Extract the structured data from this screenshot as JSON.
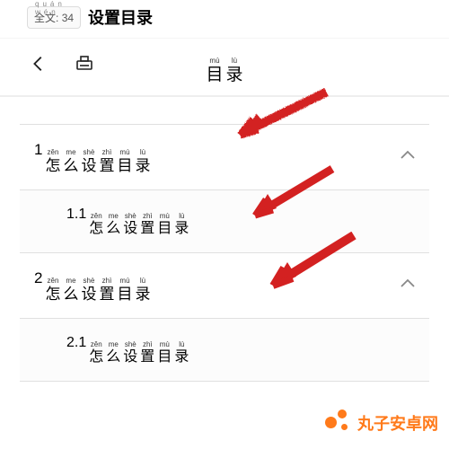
{
  "header": {
    "badge_label": "全文",
    "badge_pinyin": "quán wén",
    "badge_count": "34",
    "partial_title": "设置目录"
  },
  "toolbar": {
    "title": [
      "目",
      "录"
    ],
    "title_pinyin": [
      "mù",
      "lù"
    ]
  },
  "rows": [
    {
      "level": 1,
      "num": "1",
      "chars": [
        "怎",
        "么",
        "设",
        "置",
        "目",
        "录"
      ],
      "pinyin": [
        "zěn",
        "me",
        "shè",
        "zhì",
        "mù",
        "lù"
      ],
      "expandable": true
    },
    {
      "level": 2,
      "num": "1.1",
      "chars": [
        "怎",
        "么",
        "设",
        "置",
        "目",
        "录"
      ],
      "pinyin": [
        "zěn",
        "me",
        "shè",
        "zhì",
        "mù",
        "lù"
      ],
      "expandable": false
    },
    {
      "level": 1,
      "num": "2",
      "chars": [
        "怎",
        "么",
        "设",
        "置",
        "目",
        "录"
      ],
      "pinyin": [
        "zěn",
        "me",
        "shè",
        "zhì",
        "mù",
        "lù"
      ],
      "expandable": true
    },
    {
      "level": 2,
      "num": "2.1",
      "chars": [
        "怎",
        "么",
        "设",
        "置",
        "目",
        "录"
      ],
      "pinyin": [
        "zěn",
        "me",
        "shè",
        "zhì",
        "mù",
        "lù"
      ],
      "expandable": false
    }
  ],
  "watermark": {
    "text": "丸子安卓网"
  },
  "colors": {
    "arrow": "#d32121"
  }
}
